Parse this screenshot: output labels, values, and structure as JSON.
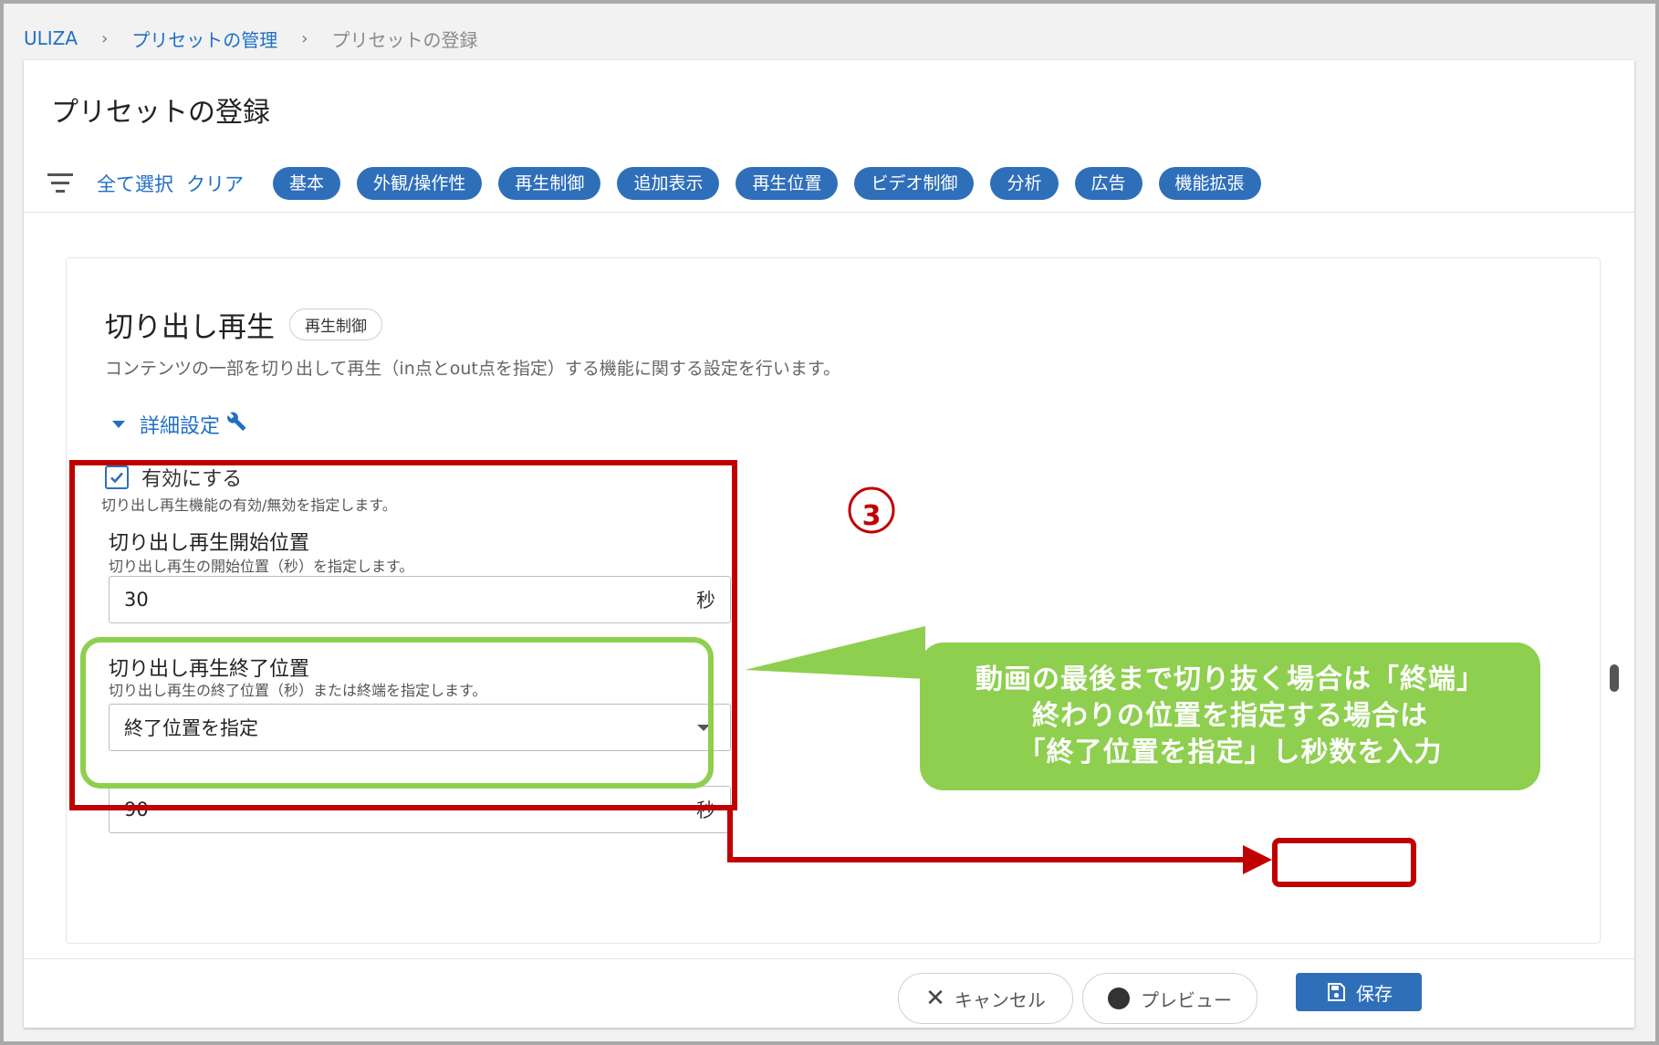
{
  "breadcrumb": {
    "root": "ULIZA",
    "parent": "プリセットの管理",
    "current": "プリセットの登録",
    "separator": "›"
  },
  "page": {
    "title": "プリセットの登録"
  },
  "filter": {
    "select_all": "全て選択",
    "clear": "クリア",
    "chips": [
      "基本",
      "外観/操作性",
      "再生制御",
      "追加表示",
      "再生位置",
      "ビデオ制御",
      "分析",
      "広告",
      "機能拡張"
    ]
  },
  "section": {
    "title": "切り出し再生",
    "tag": "再生制御",
    "description": "コンテンツの一部を切り出して再生（in点とout点を指定）する機能に関する設定を行います。",
    "advanced_label": "詳細設定",
    "enable": {
      "label": "有効にする",
      "description": "切り出し再生機能の有効/無効を指定します。",
      "checked": true
    },
    "start": {
      "label": "切り出し再生開始位置",
      "description": "切り出し再生の開始位置（秒）を指定します。",
      "value": "30",
      "unit": "秒"
    },
    "end": {
      "label": "切り出し再生終了位置",
      "description": "切り出し再生の終了位置（秒）または終端を指定します。",
      "select_value": "終了位置を指定",
      "value": "90",
      "unit": "秒"
    }
  },
  "footer": {
    "cancel": "キャンセル",
    "preview": "プレビュー",
    "save": "保存"
  },
  "annotation": {
    "step_number": "③",
    "callout_lines": [
      "動画の最後まで切り抜く場合は「終端」",
      "終わりの位置を指定する場合は",
      "「終了位置を指定」し秒数を入力"
    ],
    "colors": {
      "red": "#c00000",
      "green": "#8ecf4f"
    }
  }
}
